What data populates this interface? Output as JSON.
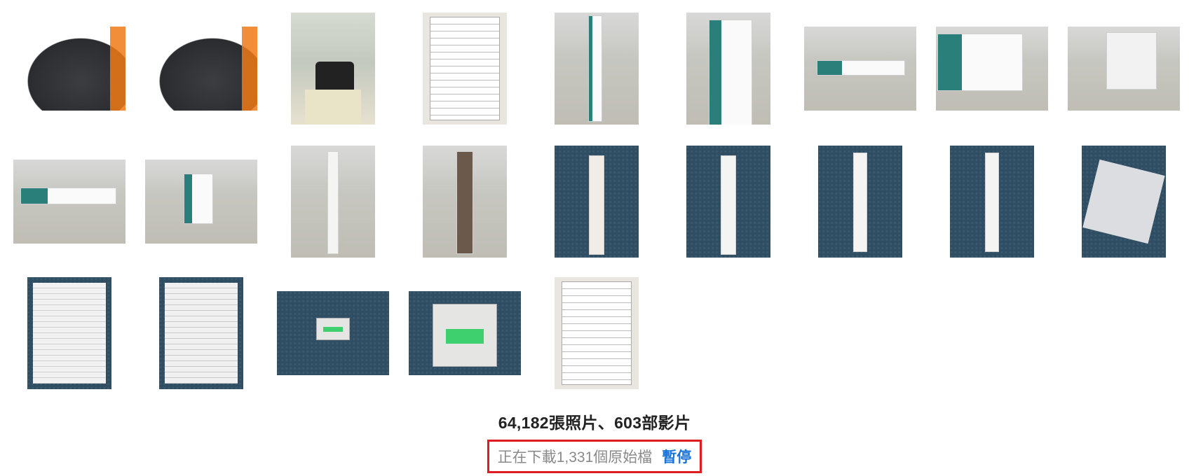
{
  "library": {
    "summary": "64,182張照片、603部影片",
    "download_status": "正在下載1,331個原始檔",
    "pause_label": "暫停"
  },
  "thumbnails": [
    {
      "name": "photo-black-disc-1",
      "kind": "black",
      "orient": "landscape"
    },
    {
      "name": "photo-black-disc-2",
      "kind": "black",
      "orient": "landscape"
    },
    {
      "name": "photo-lab-test",
      "kind": "lab",
      "orient": "square"
    },
    {
      "name": "photo-inspection-form-1",
      "kind": "doc",
      "orient": "square"
    },
    {
      "name": "photo-box-vertical",
      "kind": "floor",
      "orient": "square"
    },
    {
      "name": "photo-box-vertical-2",
      "kind": "floor",
      "orient": "square"
    },
    {
      "name": "photo-box-floor-1",
      "kind": "floor",
      "orient": "landscape"
    },
    {
      "name": "photo-box-floor-2",
      "kind": "floor",
      "orient": "landscape"
    },
    {
      "name": "photo-box-floor-3",
      "kind": "floor",
      "orient": "landscape"
    },
    {
      "name": "photo-box-floor-4",
      "kind": "floor",
      "orient": "landscape"
    },
    {
      "name": "photo-box-floor-5",
      "kind": "floor",
      "orient": "landscape"
    },
    {
      "name": "photo-blade-box",
      "kind": "floor",
      "orient": "square"
    },
    {
      "name": "photo-blade-box-open",
      "kind": "floor",
      "orient": "square"
    },
    {
      "name": "photo-blade-wrapped-1",
      "kind": "carpet",
      "orient": "square"
    },
    {
      "name": "photo-blade-wrapped-2",
      "kind": "carpet",
      "orient": "square"
    },
    {
      "name": "photo-blade-1",
      "kind": "carpet",
      "orient": "square"
    },
    {
      "name": "photo-blade-2",
      "kind": "carpet",
      "orient": "square"
    },
    {
      "name": "photo-parts-bag",
      "kind": "carpet",
      "orient": "square"
    },
    {
      "name": "photo-manual-1",
      "kind": "carpet",
      "orient": "square"
    },
    {
      "name": "photo-manual-2",
      "kind": "carpet",
      "orient": "square"
    },
    {
      "name": "photo-scale-1",
      "kind": "carpet",
      "orient": "landscape"
    },
    {
      "name": "photo-scale-2",
      "kind": "carpet",
      "orient": "landscape"
    },
    {
      "name": "photo-inspection-form-2",
      "kind": "doc",
      "orient": "square"
    }
  ]
}
